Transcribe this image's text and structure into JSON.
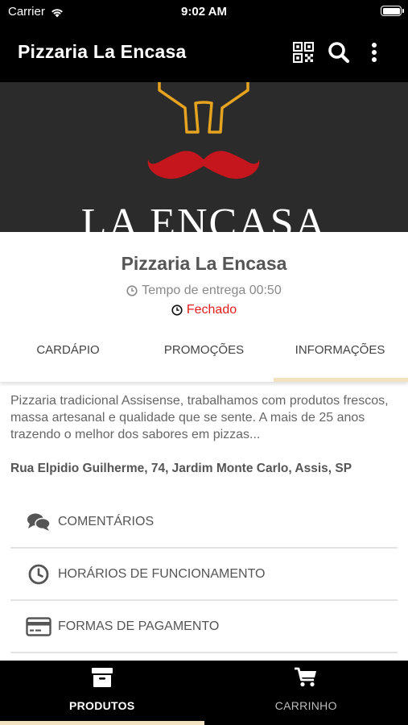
{
  "status_bar": {
    "carrier": "Carrier",
    "time": "9:02 AM"
  },
  "app_bar": {
    "title": "Pizzaria La Encasa",
    "icons": [
      "qr-code-icon",
      "search-icon",
      "more-vertical-icon"
    ]
  },
  "banner": {
    "logo_text": "LA ENCASA",
    "colors": {
      "background": "#2b2b2b",
      "hat_outline": "#e6a31f",
      "mustache": "#c4161c"
    }
  },
  "restaurant": {
    "name": "Pizzaria La Encasa",
    "delivery_time": "Tempo de entrega 00:50",
    "status": "Fechado",
    "status_color": "#e21d1d"
  },
  "tabs": [
    {
      "label": "CARDÁPIO",
      "active": false
    },
    {
      "label": "PROMOÇÕES",
      "active": false
    },
    {
      "label": "INFORMAÇÕES",
      "active": true
    }
  ],
  "info": {
    "description": "Pizzaria tradicional Assisense, trabalhamos com produtos frescos, massa artesanal e qualidade que se sente. A mais de 25 anos trazendo o melhor dos sabores em pizzas...",
    "address": "Rua Elpidio Guilherme, 74, Jardim Monte Carlo, Assis, SP"
  },
  "menu": [
    {
      "label": "COMENTÁRIOS",
      "icon": "comments-icon"
    },
    {
      "label": "HORÁRIOS DE FUNCIONAMENTO",
      "icon": "clock-icon"
    },
    {
      "label": "FORMAS DE PAGAMENTO",
      "icon": "credit-card-icon"
    }
  ],
  "bottom_nav": [
    {
      "label": "PRODUTOS",
      "icon": "archive-box-icon",
      "active": true
    },
    {
      "label": "CARRINHO",
      "icon": "shopping-cart-icon",
      "active": false
    }
  ],
  "accent_color": "#f2e2c2"
}
